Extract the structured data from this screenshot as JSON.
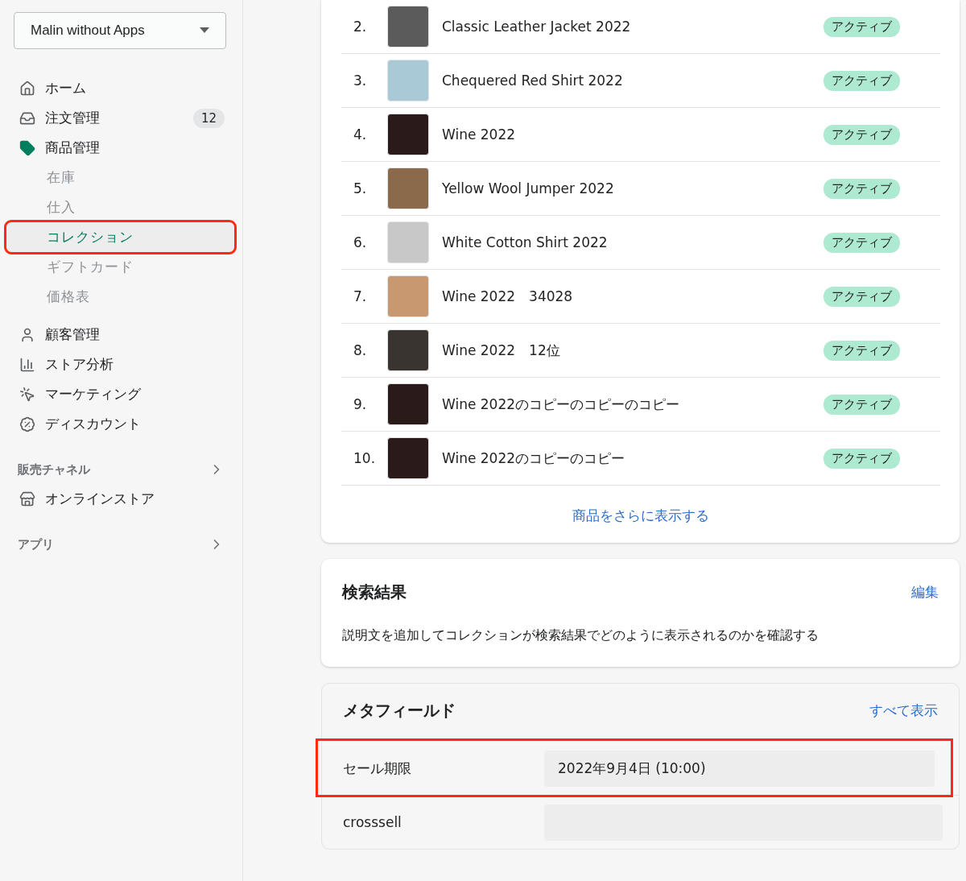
{
  "store_selector": {
    "label": "Malin without Apps"
  },
  "nav": [
    {
      "label": "ホーム",
      "selected": false
    },
    {
      "label": "注文管理",
      "selected": false,
      "badge": "12"
    },
    {
      "label": "商品管理",
      "selected": true,
      "children": [
        {
          "label": "在庫",
          "selected": false,
          "annotated": false
        },
        {
          "label": "仕入",
          "selected": false,
          "annotated": false
        },
        {
          "label": "コレクション",
          "selected": true,
          "annotated": true
        },
        {
          "label": "ギフトカード",
          "selected": false,
          "annotated": false
        },
        {
          "label": "価格表",
          "selected": false,
          "annotated": false
        }
      ]
    },
    {
      "label": "顧客管理",
      "selected": false
    },
    {
      "label": "ストア分析",
      "selected": false
    },
    {
      "label": "マーケティング",
      "selected": false
    },
    {
      "label": "ディスカウント",
      "selected": false
    }
  ],
  "sales_channels": {
    "heading": "販売チャネル",
    "items": [
      {
        "label": "オンラインストア",
        "selected": false
      }
    ]
  },
  "apps": {
    "heading": "アプリ"
  },
  "products": {
    "rows": [
      {
        "number": "2.",
        "name": "Classic Leather Jacket 2022",
        "status": "アクティブ"
      },
      {
        "number": "3.",
        "name": "Chequered Red Shirt 2022",
        "status": "アクティブ"
      },
      {
        "number": "4.",
        "name": "Wine 2022",
        "status": "アクティブ"
      },
      {
        "number": "5.",
        "name": "Yellow Wool Jumper 2022",
        "status": "アクティブ"
      },
      {
        "number": "6.",
        "name": "White Cotton Shirt 2022",
        "status": "アクティブ"
      },
      {
        "number": "7.",
        "name": "Wine 2022　34028",
        "status": "アクティブ"
      },
      {
        "number": "8.",
        "name": "Wine 2022　12位",
        "status": "アクティブ"
      },
      {
        "number": "9.",
        "name": "Wine 2022のコピーのコピーのコピー",
        "status": "アクティブ"
      },
      {
        "number": "10.",
        "name": "Wine 2022のコピーのコピー",
        "status": "アクティブ"
      }
    ],
    "more_link": "商品をさらに表示する"
  },
  "search_preview": {
    "title": "検索結果",
    "edit_link": "編集",
    "description": "説明文を追加してコレクションが検索結果でどのように表示されるのかを確認する"
  },
  "metafields": {
    "title": "メタフィールド",
    "view_all_link": "すべて表示",
    "fields": [
      {
        "label": "セール期限",
        "value": "2022年9月4日 (10:00)",
        "annotated": true
      },
      {
        "label": "crosssell",
        "annotated": false
      }
    ]
  }
}
